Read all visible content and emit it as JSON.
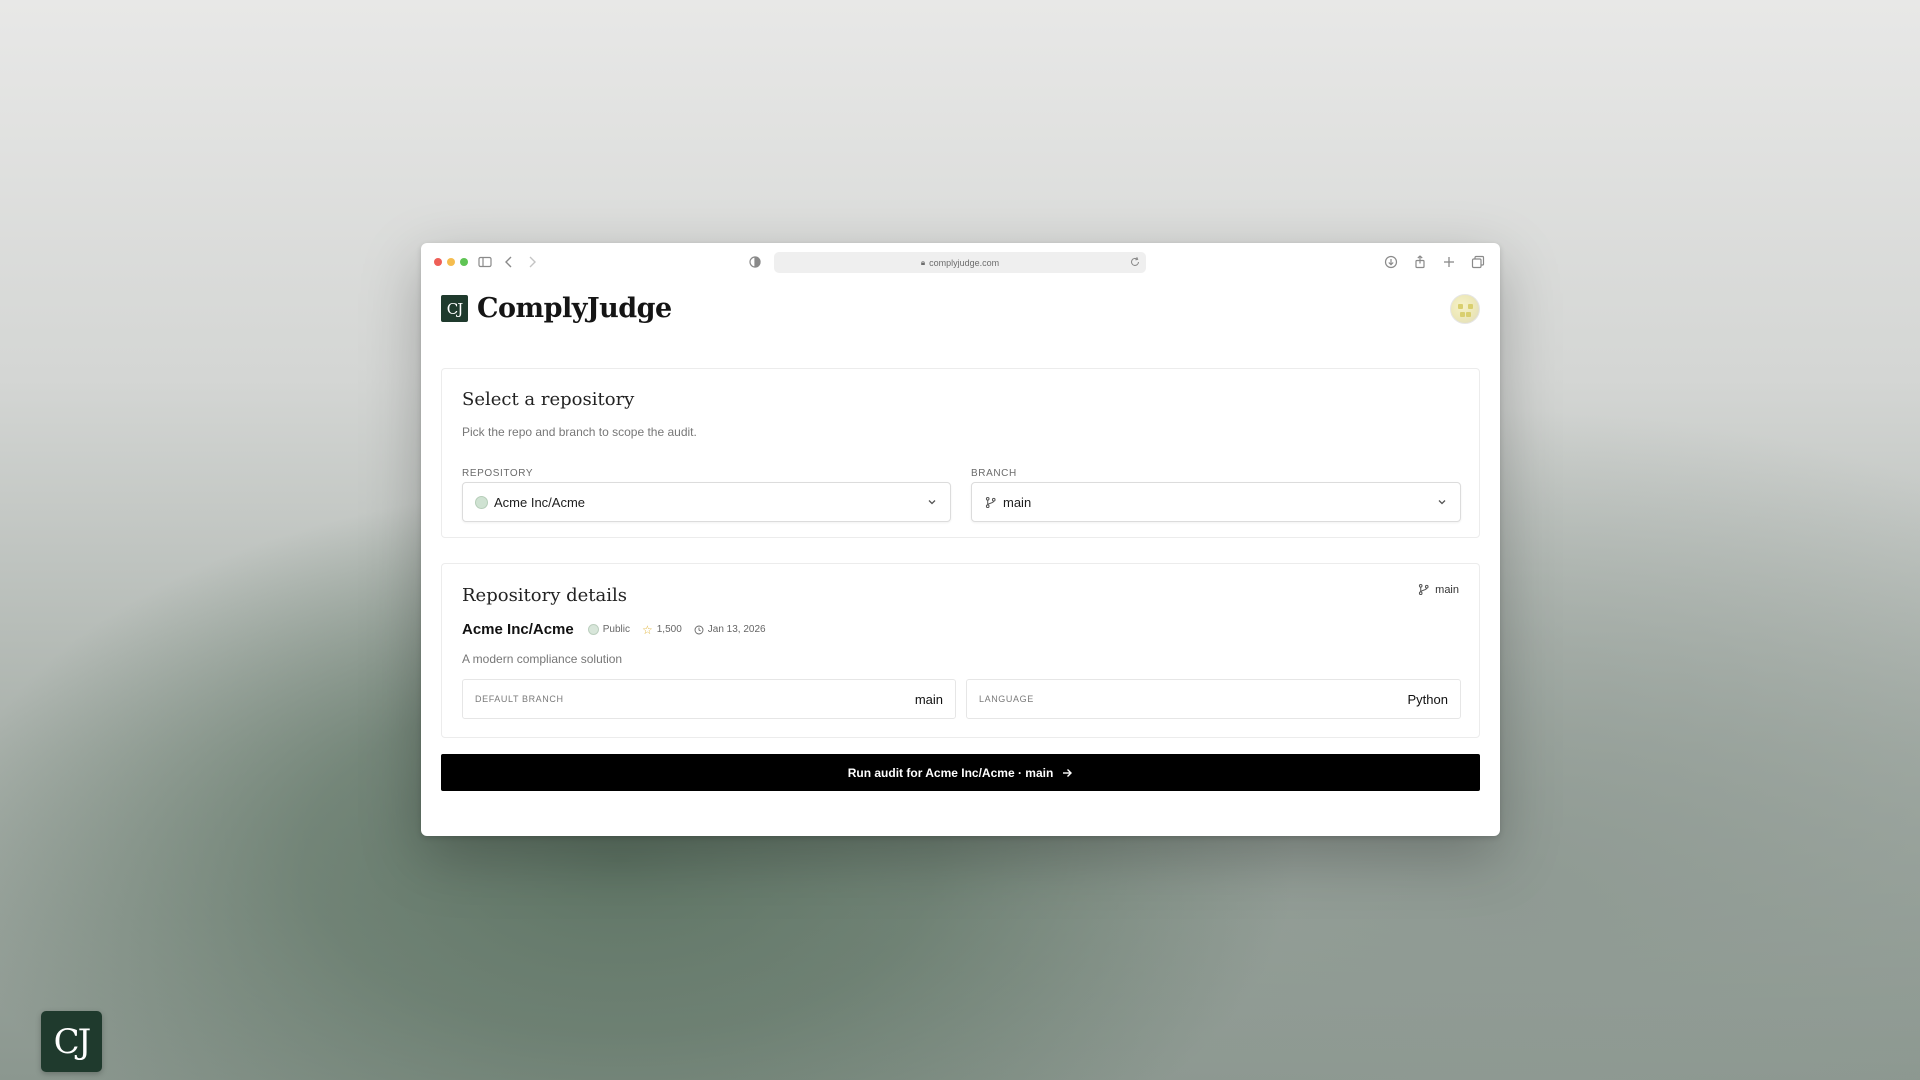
{
  "browser": {
    "url": "complyjudge.com",
    "traffic_colors": {
      "close": "#ee5f57",
      "minimize": "#f5bd4f",
      "maximize": "#5fc454"
    }
  },
  "header": {
    "logo_mark": "CJ",
    "brand_name": "ComplyJudge"
  },
  "select_card": {
    "title": "Select a repository",
    "subtitle": "Pick the repo and branch to scope the audit.",
    "repository_label": "REPOSITORY",
    "repository_value": "Acme Inc/Acme",
    "branch_label": "BRANCH",
    "branch_value": "main"
  },
  "details_card": {
    "title": "Repository details",
    "branch_tag": "main",
    "repo_name": "Acme Inc/Acme",
    "visibility": "Public",
    "stars": "1,500",
    "date": "Jan 13, 2026",
    "description": "A modern compliance solution",
    "default_branch_label": "DEFAULT BRANCH",
    "default_branch_value": "main",
    "language_label": "LANGUAGE",
    "language_value": "Python"
  },
  "run_button": {
    "label": "Run audit for Acme Inc/Acme · main"
  },
  "corner_logo": "CJ",
  "colors": {
    "brand_dark_green": "#1f3a2d",
    "button_black": "#000000",
    "star_gold": "#e0b43a"
  }
}
